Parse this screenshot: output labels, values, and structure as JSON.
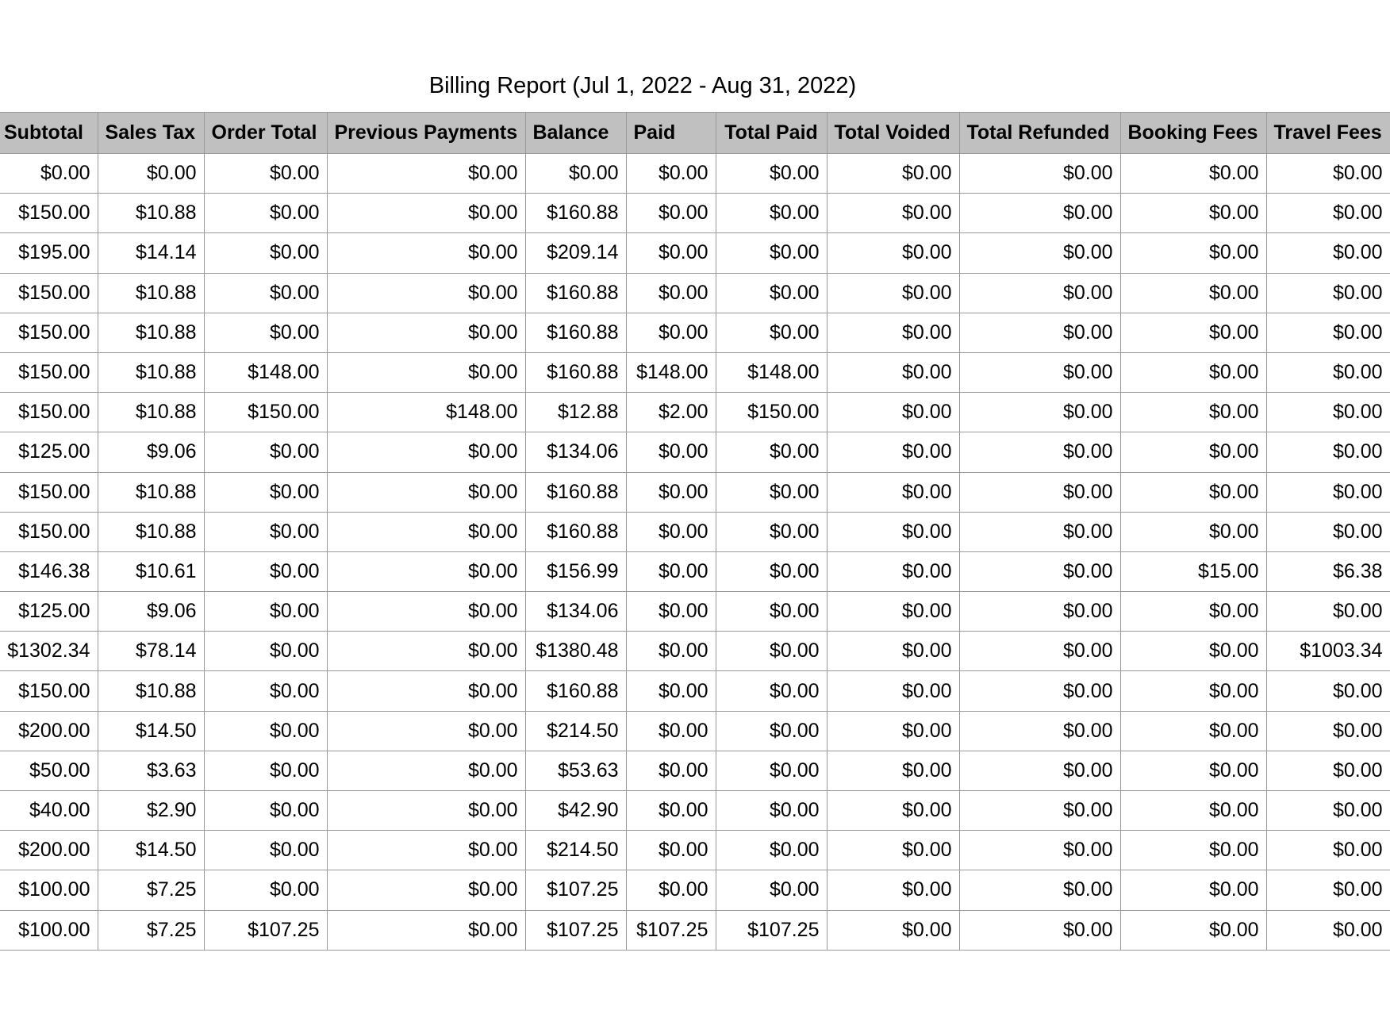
{
  "title": "Billing Report (Jul 1, 2022 - Aug 31, 2022)",
  "columns": [
    "Subtotal",
    "Sales Tax",
    "Order Total",
    "Previous Payments",
    "Balance",
    "Paid",
    "Total Paid",
    "Total Voided",
    "Total Refunded",
    "Booking Fees",
    "Travel Fees"
  ],
  "rows": [
    [
      "$0.00",
      "$0.00",
      "$0.00",
      "$0.00",
      "$0.00",
      "$0.00",
      "$0.00",
      "$0.00",
      "$0.00",
      "$0.00",
      "$0.00"
    ],
    [
      "$150.00",
      "$10.88",
      "$0.00",
      "$0.00",
      "$160.88",
      "$0.00",
      "$0.00",
      "$0.00",
      "$0.00",
      "$0.00",
      "$0.00"
    ],
    [
      "$195.00",
      "$14.14",
      "$0.00",
      "$0.00",
      "$209.14",
      "$0.00",
      "$0.00",
      "$0.00",
      "$0.00",
      "$0.00",
      "$0.00"
    ],
    [
      "$150.00",
      "$10.88",
      "$0.00",
      "$0.00",
      "$160.88",
      "$0.00",
      "$0.00",
      "$0.00",
      "$0.00",
      "$0.00",
      "$0.00"
    ],
    [
      "$150.00",
      "$10.88",
      "$0.00",
      "$0.00",
      "$160.88",
      "$0.00",
      "$0.00",
      "$0.00",
      "$0.00",
      "$0.00",
      "$0.00"
    ],
    [
      "$150.00",
      "$10.88",
      "$148.00",
      "$0.00",
      "$160.88",
      "$148.00",
      "$148.00",
      "$0.00",
      "$0.00",
      "$0.00",
      "$0.00"
    ],
    [
      "$150.00",
      "$10.88",
      "$150.00",
      "$148.00",
      "$12.88",
      "$2.00",
      "$150.00",
      "$0.00",
      "$0.00",
      "$0.00",
      "$0.00"
    ],
    [
      "$125.00",
      "$9.06",
      "$0.00",
      "$0.00",
      "$134.06",
      "$0.00",
      "$0.00",
      "$0.00",
      "$0.00",
      "$0.00",
      "$0.00"
    ],
    [
      "$150.00",
      "$10.88",
      "$0.00",
      "$0.00",
      "$160.88",
      "$0.00",
      "$0.00",
      "$0.00",
      "$0.00",
      "$0.00",
      "$0.00"
    ],
    [
      "$150.00",
      "$10.88",
      "$0.00",
      "$0.00",
      "$160.88",
      "$0.00",
      "$0.00",
      "$0.00",
      "$0.00",
      "$0.00",
      "$0.00"
    ],
    [
      "$146.38",
      "$10.61",
      "$0.00",
      "$0.00",
      "$156.99",
      "$0.00",
      "$0.00",
      "$0.00",
      "$0.00",
      "$15.00",
      "$6.38"
    ],
    [
      "$125.00",
      "$9.06",
      "$0.00",
      "$0.00",
      "$134.06",
      "$0.00",
      "$0.00",
      "$0.00",
      "$0.00",
      "$0.00",
      "$0.00"
    ],
    [
      "$1302.34",
      "$78.14",
      "$0.00",
      "$0.00",
      "$1380.48",
      "$0.00",
      "$0.00",
      "$0.00",
      "$0.00",
      "$0.00",
      "$1003.34"
    ],
    [
      "$150.00",
      "$10.88",
      "$0.00",
      "$0.00",
      "$160.88",
      "$0.00",
      "$0.00",
      "$0.00",
      "$0.00",
      "$0.00",
      "$0.00"
    ],
    [
      "$200.00",
      "$14.50",
      "$0.00",
      "$0.00",
      "$214.50",
      "$0.00",
      "$0.00",
      "$0.00",
      "$0.00",
      "$0.00",
      "$0.00"
    ],
    [
      "$50.00",
      "$3.63",
      "$0.00",
      "$0.00",
      "$53.63",
      "$0.00",
      "$0.00",
      "$0.00",
      "$0.00",
      "$0.00",
      "$0.00"
    ],
    [
      "$40.00",
      "$2.90",
      "$0.00",
      "$0.00",
      "$42.90",
      "$0.00",
      "$0.00",
      "$0.00",
      "$0.00",
      "$0.00",
      "$0.00"
    ],
    [
      "$200.00",
      "$14.50",
      "$0.00",
      "$0.00",
      "$214.50",
      "$0.00",
      "$0.00",
      "$0.00",
      "$0.00",
      "$0.00",
      "$0.00"
    ],
    [
      "$100.00",
      "$7.25",
      "$0.00",
      "$0.00",
      "$107.25",
      "$0.00",
      "$0.00",
      "$0.00",
      "$0.00",
      "$0.00",
      "$0.00"
    ],
    [
      "$100.00",
      "$7.25",
      "$107.25",
      "$0.00",
      "$107.25",
      "$107.25",
      "$107.25",
      "$0.00",
      "$0.00",
      "$0.00",
      "$0.00"
    ]
  ]
}
